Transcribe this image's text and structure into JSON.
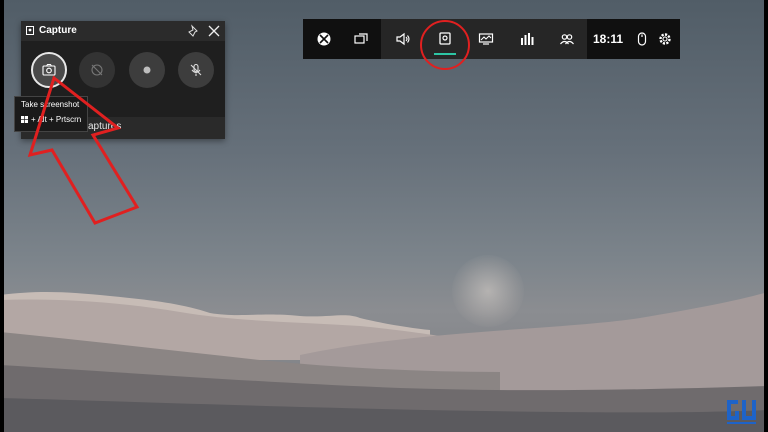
{
  "capture_widget": {
    "title": "Capture",
    "footer_text": "captures",
    "tooltip": {
      "line1": "Take screenshot",
      "line2": "+ Alt + Prtscrn"
    },
    "buttons": [
      {
        "name": "screenshot",
        "icon": "camera-icon"
      },
      {
        "name": "record-last-30s",
        "icon": "replay-icon"
      },
      {
        "name": "start-recording",
        "icon": "record-dot-icon"
      },
      {
        "name": "mic",
        "icon": "mic-off-icon"
      }
    ]
  },
  "gamebar": {
    "clock": "18:11",
    "items": [
      "xbox-icon",
      "widget-menu-icon",
      "audio-icon",
      "capture-icon",
      "performance-icon",
      "resources-icon",
      "social-icon",
      "mouse-icon",
      "settings-icon"
    ],
    "active_item": "capture-icon",
    "accent": "#2dc5a4"
  },
  "annotations": {
    "color": "#e02020"
  },
  "watermark": {
    "text": "GU"
  }
}
